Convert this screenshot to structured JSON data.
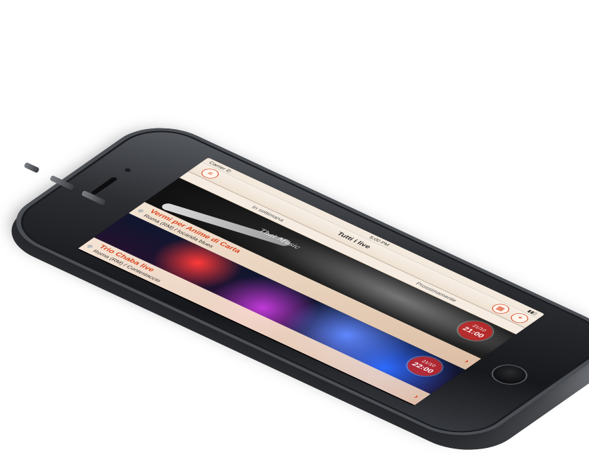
{
  "status_bar": {
    "carrier": "Carrier ✆",
    "time": "5:00 PM"
  },
  "nav": {
    "title": "Tutti i live"
  },
  "tabs": [
    {
      "label": "In settimana",
      "active": false
    },
    {
      "label": "Prossimamente",
      "active": false
    }
  ],
  "events": [
    {
      "title": "Vermi per Anime di Carta",
      "place": "Roma (RM) / locanda blues",
      "date": "21/10",
      "time": "21:00",
      "overlay_text": "That Music"
    },
    {
      "title": "Trio Chaba live",
      "place": "Roma (RM) / Contestaccio",
      "date": "21/10",
      "time": "22:00"
    }
  ],
  "colors": {
    "accent": "#d9441e",
    "header_bg": "#f3e9dc"
  },
  "icons": {
    "menu": "menu-icon",
    "calendar": "calendar-icon",
    "location": "location-icon",
    "pin": "pin-icon",
    "chevron": "chevron-right-icon"
  }
}
